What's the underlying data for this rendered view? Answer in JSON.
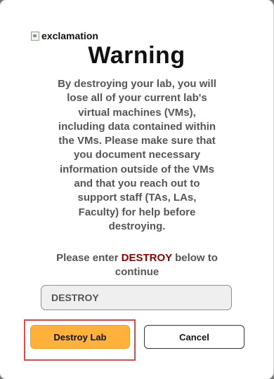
{
  "dialog": {
    "image_alt": "exclamation",
    "title": "Warning",
    "message": "By destroying your lab, you will lose all of your current lab's virtual machines (VMs), including data contained within the VMs. Please make sure that you document necessary information outside of the VMs and that you reach out to support staff (TAs, LAs, Faculty) for help before destroying.",
    "prompt_before": "Please enter ",
    "prompt_keyword": "DESTROY",
    "prompt_after": " below to continue",
    "input_value": "DESTROY",
    "destroy_button": "Destroy Lab",
    "cancel_button": "Cancel"
  },
  "colors": {
    "accent_button": "#ffb13c",
    "keyword": "#8b0000",
    "highlight_box": "#e04a4a"
  }
}
